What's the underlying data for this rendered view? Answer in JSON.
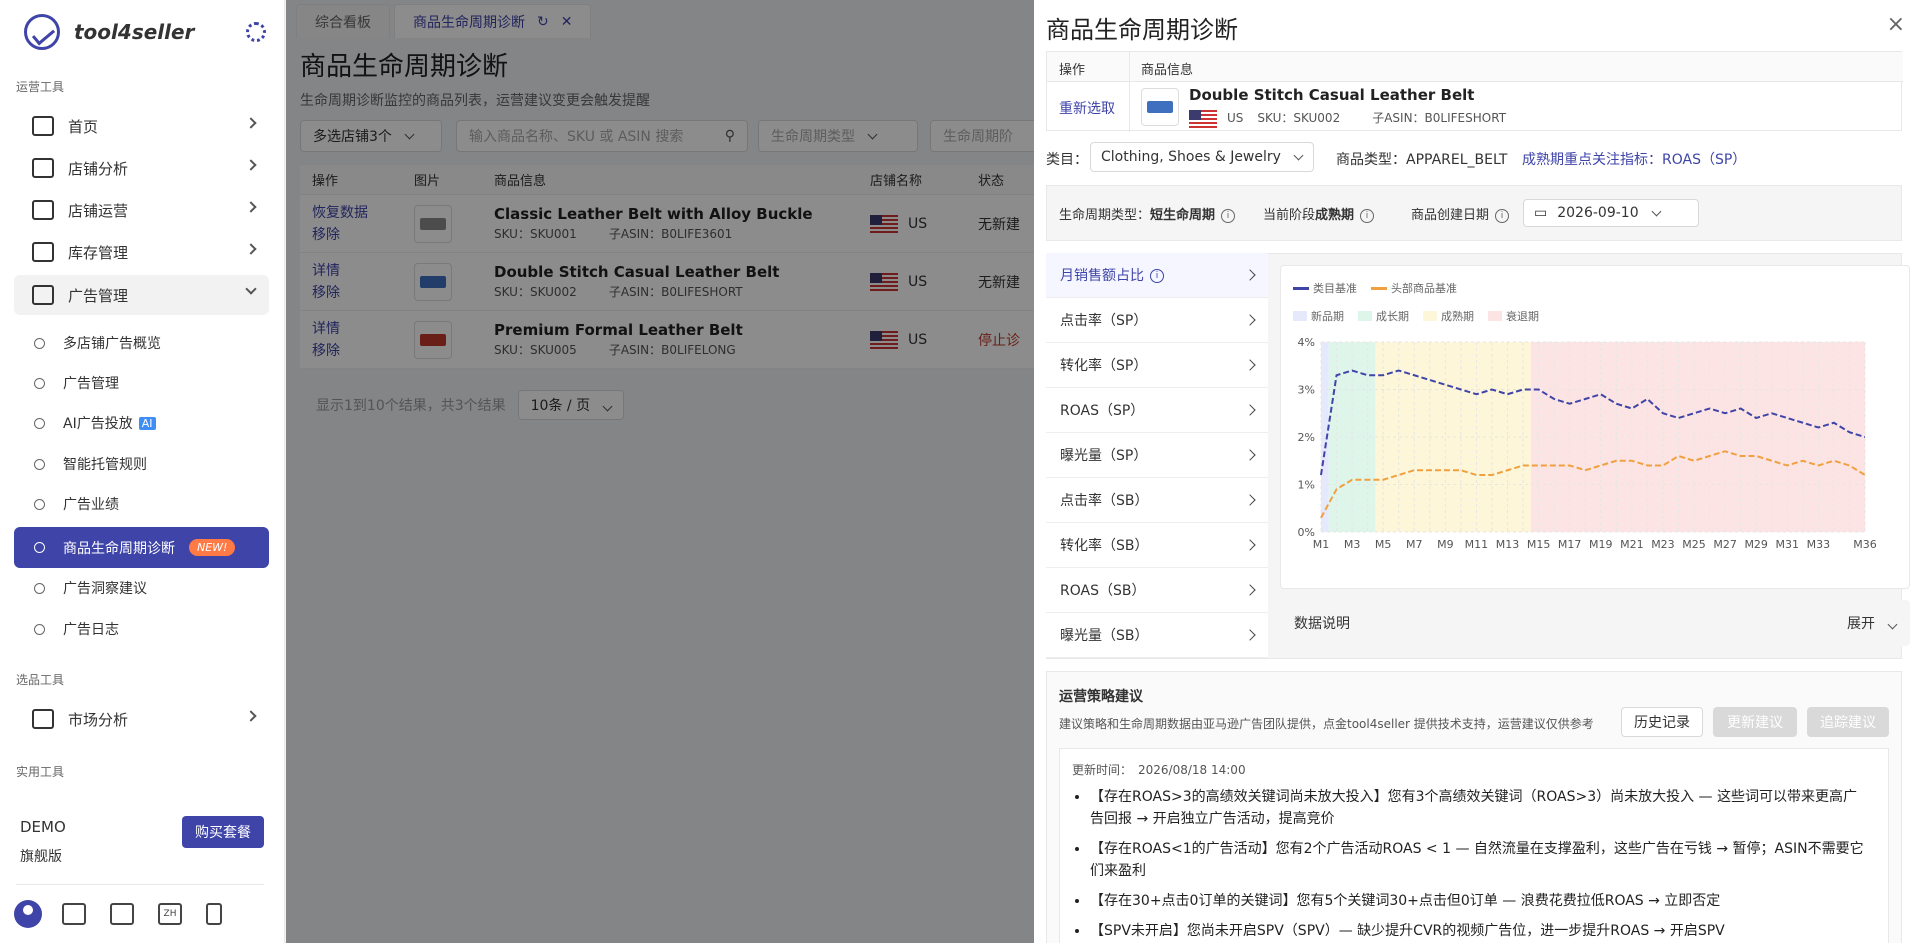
{
  "sidebar": {
    "brand": "tool4seller",
    "sec_ops": "运营工具",
    "home": "首页",
    "shop_analysis": "店铺分析",
    "shop_ops": "店铺运营",
    "inventory": "库存管理",
    "ads": "广告管理",
    "sub": {
      "multi": "多店铺广告概览",
      "manage": "广告管理",
      "ai": "AI广告投放",
      "ai_tag": "AI",
      "auto": "智能托管规则",
      "perf": "广告业绩",
      "lifecycle": "商品生命周期诊断",
      "new_tag": "NEW!",
      "insight": "广告洞察建议",
      "log": "广告日志"
    },
    "sec_select": "选品工具",
    "market": "市场分析",
    "sec_util": "实用工具",
    "demo": "DEMO",
    "plan": "旗舰版",
    "buy": "购买套餐",
    "zh": "ZH"
  },
  "tabs": {
    "dashboard": "综合看板",
    "current": "商品生命周期诊断"
  },
  "page": {
    "title": "商品生命周期诊断",
    "subtitle": "生命周期诊断监控的商品列表，运营建议变更会触发提醒",
    "filters": {
      "shops": "多选店铺3个",
      "search_ph": "输入商品名称、SKU 或 ASIN 搜索",
      "type_ph": "生命周期类型",
      "stage_ph": "生命周期阶"
    },
    "headers": {
      "op": "操作",
      "img": "图片",
      "info": "商品信息",
      "store": "店铺名称",
      "status": "状态"
    },
    "rows": [
      {
        "op1": "恢复数据",
        "op2": "移除",
        "name": "Classic Leather Belt with Alloy Buckle",
        "sku": "SKU：SKU001",
        "asin": "子ASIN：B0LIFE3601",
        "store": "US",
        "status": "无新建",
        "color": "#8a8a8a"
      },
      {
        "op1": "详情",
        "op2": "移除",
        "name": "Double Stitch Casual Leather Belt",
        "sku": "SKU：SKU002",
        "asin": "子ASIN：B0LIFESHORT",
        "store": "US",
        "status": "无新建",
        "color": "#3f6fbf"
      },
      {
        "op1": "详情",
        "op2": "移除",
        "name": "Premium Formal Leather Belt",
        "sku": "SKU：SKU005",
        "asin": "子ASIN：B0LIFELONG",
        "store": "US",
        "status": "停止诊",
        "color": "#c0392b"
      }
    ],
    "pager": "显示1到10个结果，共3个结果",
    "page_size": "10条 / 页"
  },
  "drawer": {
    "title": "商品生命周期诊断",
    "close": "×",
    "op_header": "操作",
    "info_header": "商品信息",
    "reselect": "重新选取",
    "product": {
      "name": "Double Stitch Casual Leather Belt",
      "store": "US",
      "sku": "SKU：SKU002",
      "asin": "子ASIN：B0LIFESHORT"
    },
    "category_label": "类目：",
    "category": "Clothing, Shoes & Jewelry",
    "ptype": "商品类型：APPAREL_BELT",
    "focus": "成熟期重点关注指标：ROAS（SP）",
    "lc_type_label": "生命周期类型：",
    "lc_type": "短生命周期",
    "stage_label": "当前阶段",
    "stage": "成熟期",
    "date_label": "商品创建日期",
    "date": "2026-09-10",
    "metrics": [
      "月销售额占比",
      "点击率（SP）",
      "转化率（SP）",
      "ROAS（SP）",
      "曝光量（SP）",
      "点击率（SB）",
      "转化率（SB）",
      "ROAS（SB）",
      "曝光量（SB）"
    ],
    "explain": "数据说明",
    "expand": "展开",
    "strategy": {
      "title": "运营策略建议",
      "desc": "建议策略和生命周期数据由亚马逊广告团队提供，点金tool4seller 提供技术支持，运营建议仅供参考",
      "history": "历史记录",
      "update": "更新建议",
      "track": "追踪建议",
      "time_label": "更新时间：",
      "time": "2026/08/18 14:00",
      "items": [
        "【存在ROAS>3的高绩效关键词尚未放大投入】您有3个高绩效关键词（ROAS>3）尚未放大投入 — 这些词可以带来更高广告回报 → 开启独立广告活动，提高竞价",
        "【存在ROAS<1的广告活动】您有2个广告活动ROAS < 1 — 自然流量在支撑盈利，这些广告在亏钱 → 暂停；ASIN不需要它们来盈利",
        "【存在30+点击0订单的关键词】您有5个关键词30+点击但0订单 — 浪费花费拉低ROAS → 立即否定",
        "【SPV未开启】您尚未开启SPV（SPV）— 缺少提升CVR的视频广告位，进一步提升ROAS → 开启SPV"
      ]
    }
  },
  "chart_data": {
    "type": "line",
    "legend": [
      "类目基准",
      "头部商品基准"
    ],
    "phases": [
      "新品期",
      "成长期",
      "成熟期",
      "衰退期"
    ],
    "phase_colors": [
      "#e6e8fb",
      "#def5ea",
      "#fdf6d8",
      "#fde4e4"
    ],
    "phase_ranges": [
      [
        1,
        1.5
      ],
      [
        1.5,
        4.5
      ],
      [
        4.5,
        14.5
      ],
      [
        14.5,
        36
      ]
    ],
    "x": [
      "M1",
      "M2",
      "M3",
      "M4",
      "M5",
      "M6",
      "M7",
      "M8",
      "M9",
      "M10",
      "M11",
      "M12",
      "M13",
      "M14",
      "M15",
      "M16",
      "M17",
      "M18",
      "M19",
      "M20",
      "M21",
      "M22",
      "M23",
      "M24",
      "M25",
      "M26",
      "M27",
      "M28",
      "M29",
      "M30",
      "M31",
      "M32",
      "M33",
      "M34",
      "M35",
      "M36"
    ],
    "x_ticks": [
      "M1",
      "M3",
      "M5",
      "M7",
      "M9",
      "M11",
      "M13",
      "M15",
      "M17",
      "M19",
      "M21",
      "M23",
      "M25",
      "M27",
      "M29",
      "M31",
      "M33",
      "M36"
    ],
    "y_ticks": [
      "0%",
      "1%",
      "2%",
      "3%",
      "4%"
    ],
    "ylim": [
      0,
      4
    ],
    "series": [
      {
        "name": "类目基准",
        "color": "#3f44a8",
        "values": [
          1.2,
          3.3,
          3.4,
          3.3,
          3.3,
          3.4,
          3.3,
          3.2,
          3.1,
          3.0,
          2.9,
          3.0,
          2.9,
          3.0,
          3.0,
          2.8,
          2.7,
          2.8,
          2.9,
          2.7,
          2.6,
          2.8,
          2.5,
          2.4,
          2.5,
          2.6,
          2.5,
          2.6,
          2.4,
          2.5,
          2.4,
          2.3,
          2.2,
          2.3,
          2.1,
          2.0
        ]
      },
      {
        "name": "头部商品基准",
        "color": "#f0a040",
        "values": [
          0.3,
          0.9,
          1.1,
          1.1,
          1.1,
          1.2,
          1.3,
          1.3,
          1.3,
          1.3,
          1.2,
          1.2,
          1.3,
          1.4,
          1.4,
          1.4,
          1.4,
          1.3,
          1.4,
          1.5,
          1.5,
          1.4,
          1.4,
          1.6,
          1.5,
          1.6,
          1.7,
          1.6,
          1.6,
          1.5,
          1.4,
          1.5,
          1.4,
          1.5,
          1.4,
          1.2
        ]
      }
    ]
  }
}
